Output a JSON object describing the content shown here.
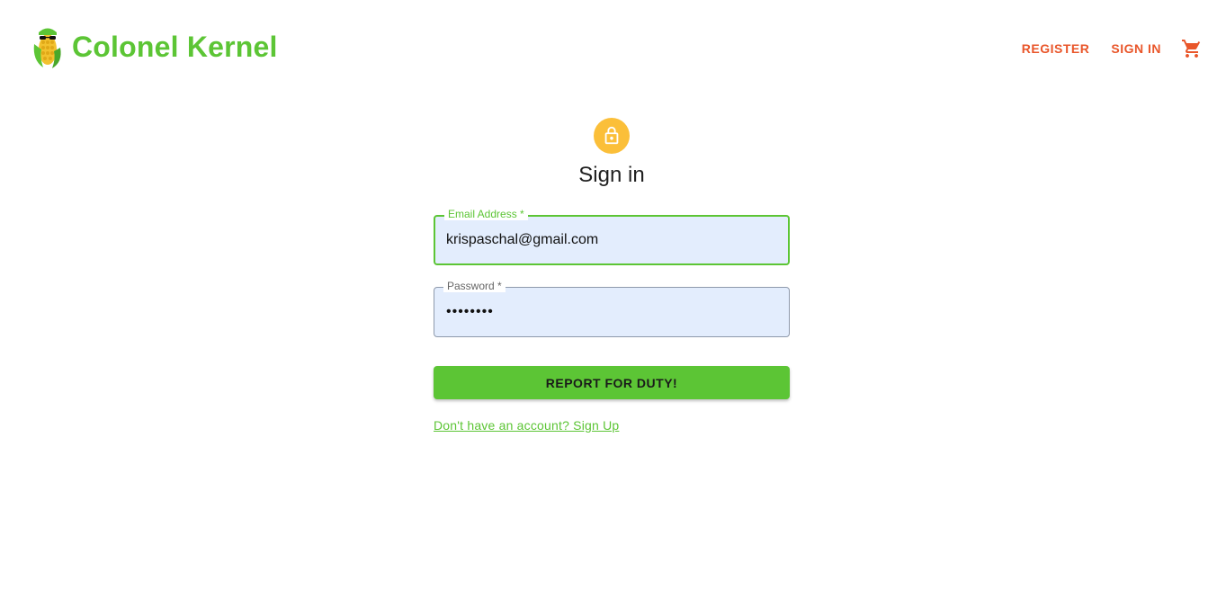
{
  "header": {
    "brand_name": "Colonel Kernel",
    "logo_icon": "corn-mascot-logo",
    "nav": {
      "register_label": "REGISTER",
      "signin_label": "SIGN IN"
    },
    "cart_icon": "shopping-cart-icon"
  },
  "form": {
    "title": "Sign in",
    "email": {
      "label": "Email Address *",
      "value": "krispaschal@gmail.com"
    },
    "password": {
      "label": "Password *",
      "value": "••••••••"
    },
    "submit_label": "REPORT FOR DUTY!",
    "signup_link": "Don't have an account? Sign Up"
  },
  "colors": {
    "brand_green": "#5cc535",
    "nav_orange": "#e9562a",
    "lock_yellow": "#fbbf39",
    "input_fill": "#e3edfd"
  }
}
